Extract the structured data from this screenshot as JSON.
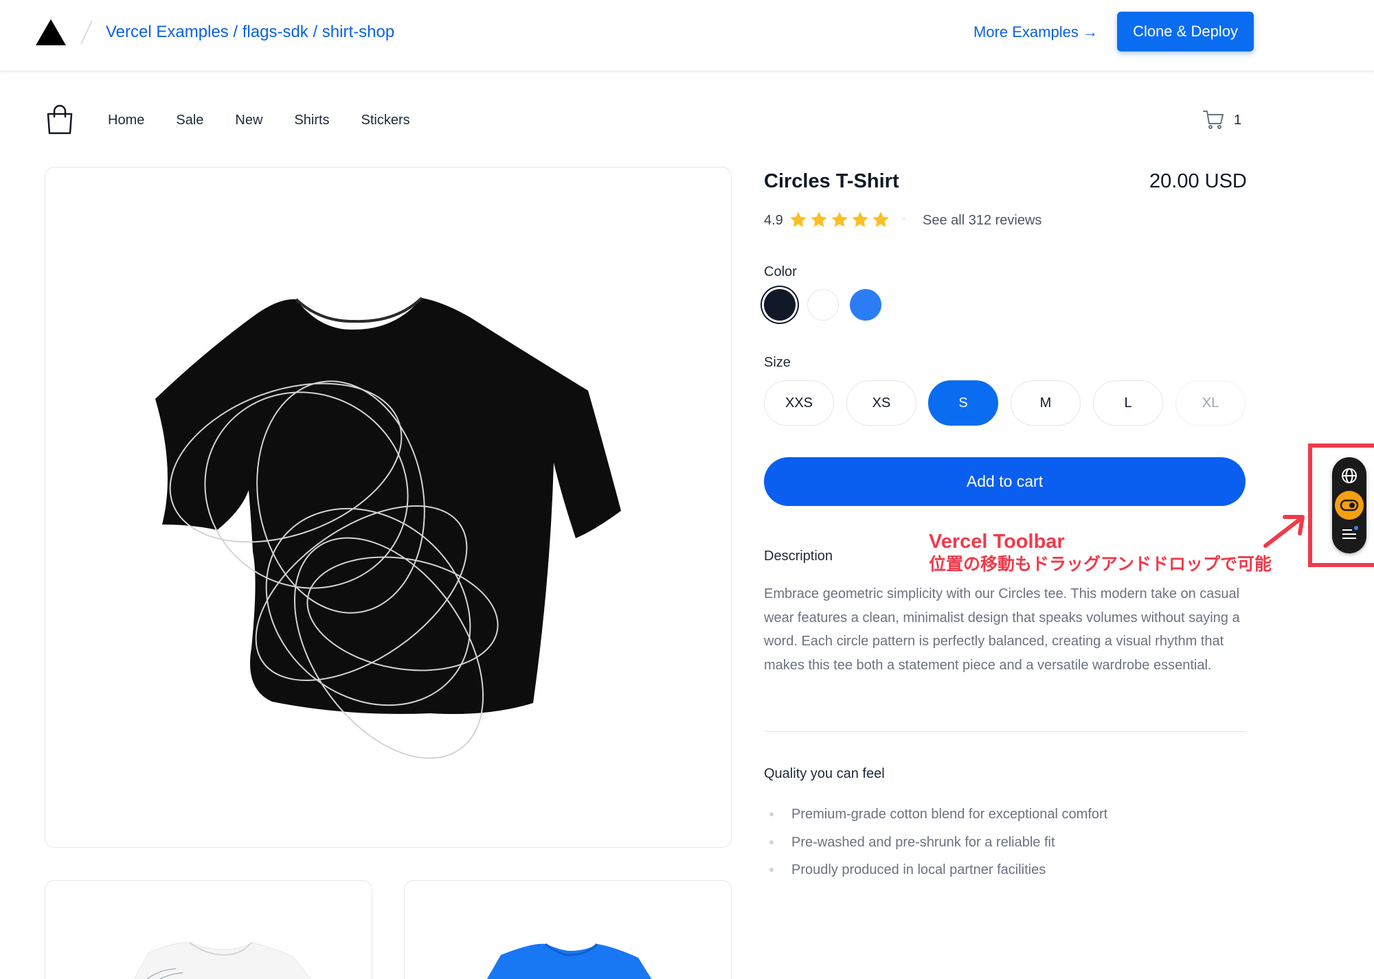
{
  "banner": {
    "breadcrumb": "Vercel Examples / flags-sdk / shirt-shop",
    "more_examples": "More Examples →",
    "clone_deploy": "Clone & Deploy"
  },
  "nav": {
    "items": [
      "Home",
      "Sale",
      "New",
      "Shirts",
      "Stickers"
    ],
    "cart_count": "1"
  },
  "product": {
    "title": "Circles T-Shirt",
    "price": "20.00 USD",
    "rating": "4.9",
    "stars": 5,
    "separator": "·",
    "reviews_link": "See all 312 reviews",
    "color_label": "Color",
    "colors": [
      {
        "name": "black",
        "hex": "#111827",
        "selected": true
      },
      {
        "name": "white",
        "hex": "#ffffff",
        "selected": false
      },
      {
        "name": "blue",
        "hex": "#2b7df5",
        "selected": false
      }
    ],
    "size_label": "Size",
    "sizes": [
      "XXS",
      "XS",
      "S",
      "M",
      "L",
      "XL"
    ],
    "selected_size": "S",
    "disabled_size": "XL",
    "add_to_cart": "Add to cart",
    "description_label": "Description",
    "description": "Embrace geometric simplicity with our Circles tee. This modern take on casual wear features a clean, minimalist design that speaks volumes without saying a word. Each circle pattern is perfectly balanced, creating a visual rhythm that makes this tee both a statement piece and a versatile wardrobe essential.",
    "quality_label": "Quality you can feel",
    "quality_points": [
      "Premium-grade cotton blend for exceptional comfort",
      "Pre-washed and pre-shrunk for a reliable fit",
      "Proudly produced in local partner facilities"
    ]
  },
  "annotation": {
    "title": "Vercel Toolbar",
    "subtitle": "位置の移動もドラッグアンドドロップで可能"
  },
  "colors": {
    "accent": "#0a6cf1",
    "link": "#0a62e0",
    "annotation": "#f03a4a",
    "star": "#fbbf24",
    "toolbar_toggle": "#f5a00f"
  },
  "icons": [
    "vercel-logo-icon",
    "shopping-bag-icon",
    "cart-icon",
    "star-icon",
    "globe-icon",
    "toggle-icon",
    "menu-icon",
    "arrow-icon"
  ]
}
